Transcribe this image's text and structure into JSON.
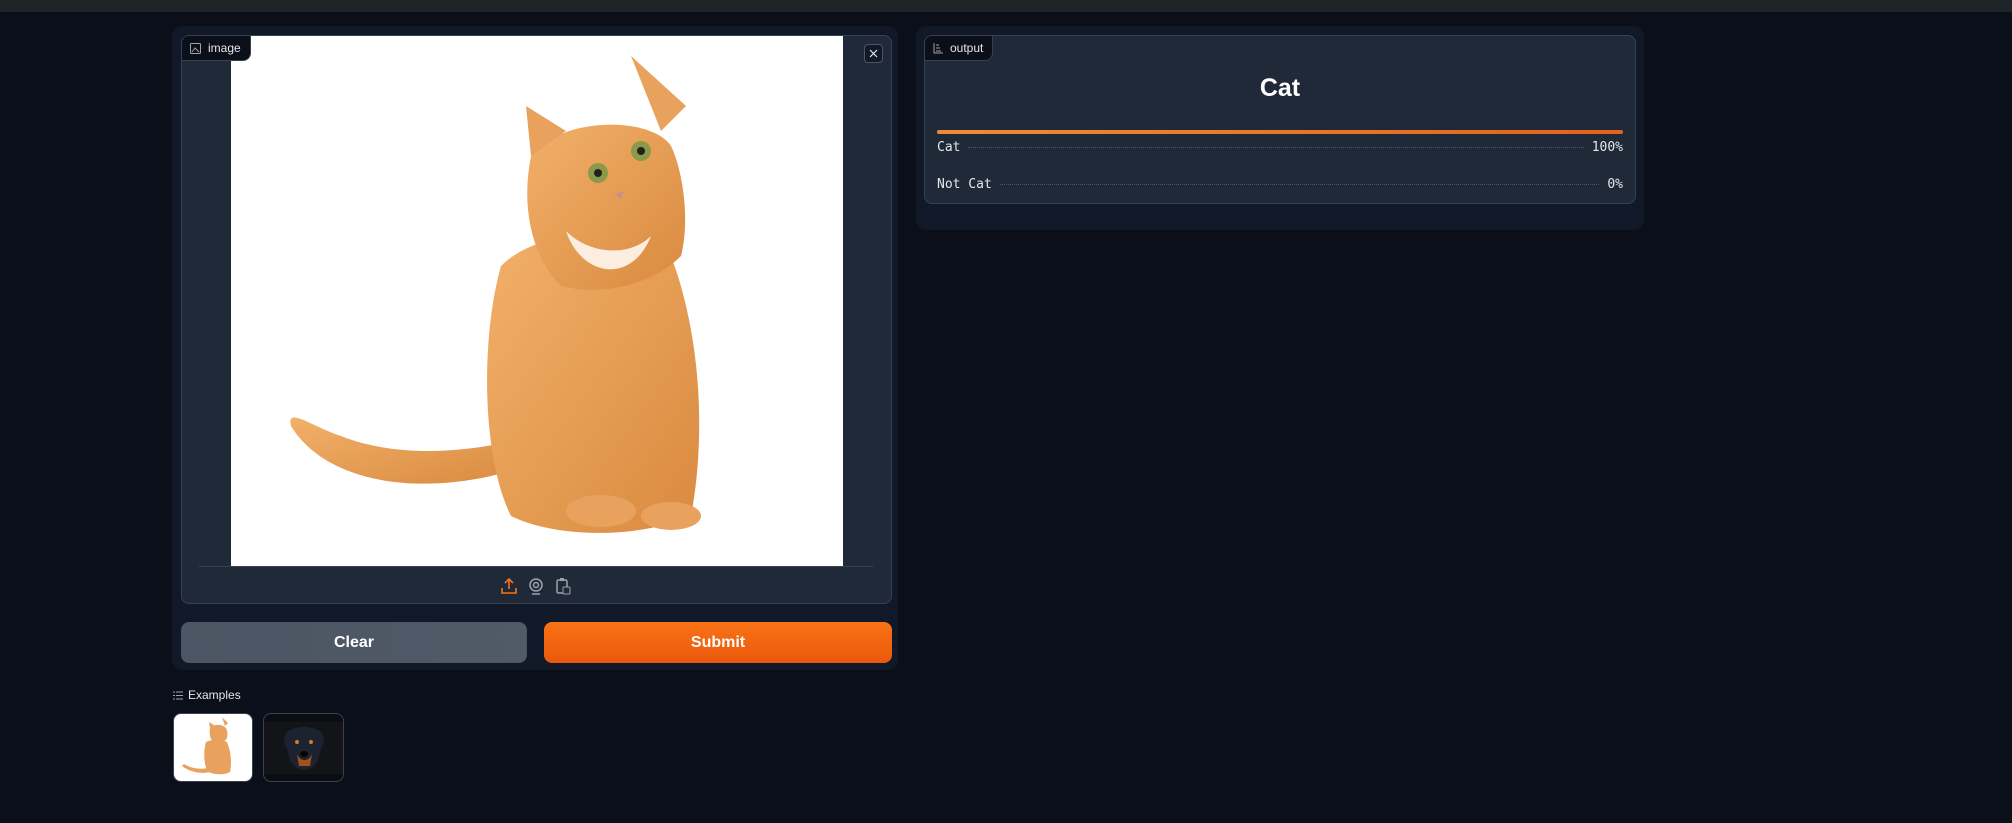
{
  "input": {
    "label": "image",
    "icons": [
      "image-icon",
      "close-icon",
      "upload-icon",
      "webcam-icon",
      "clipboard-icon"
    ]
  },
  "buttons": {
    "clear": "Clear",
    "submit": "Submit"
  },
  "output": {
    "label": "output",
    "top_label": "Cat",
    "confidences": [
      {
        "label": "Cat",
        "value": "100%",
        "fraction": 1.0
      },
      {
        "label": "Not Cat",
        "value": "0%",
        "fraction": 0.0
      }
    ]
  },
  "examples": {
    "label": "Examples",
    "items": [
      "cat-example",
      "dog-example"
    ]
  },
  "colors": {
    "accent": "#f97316",
    "background": "#0b0f19",
    "panel": "#111827",
    "block": "#1f2937"
  }
}
